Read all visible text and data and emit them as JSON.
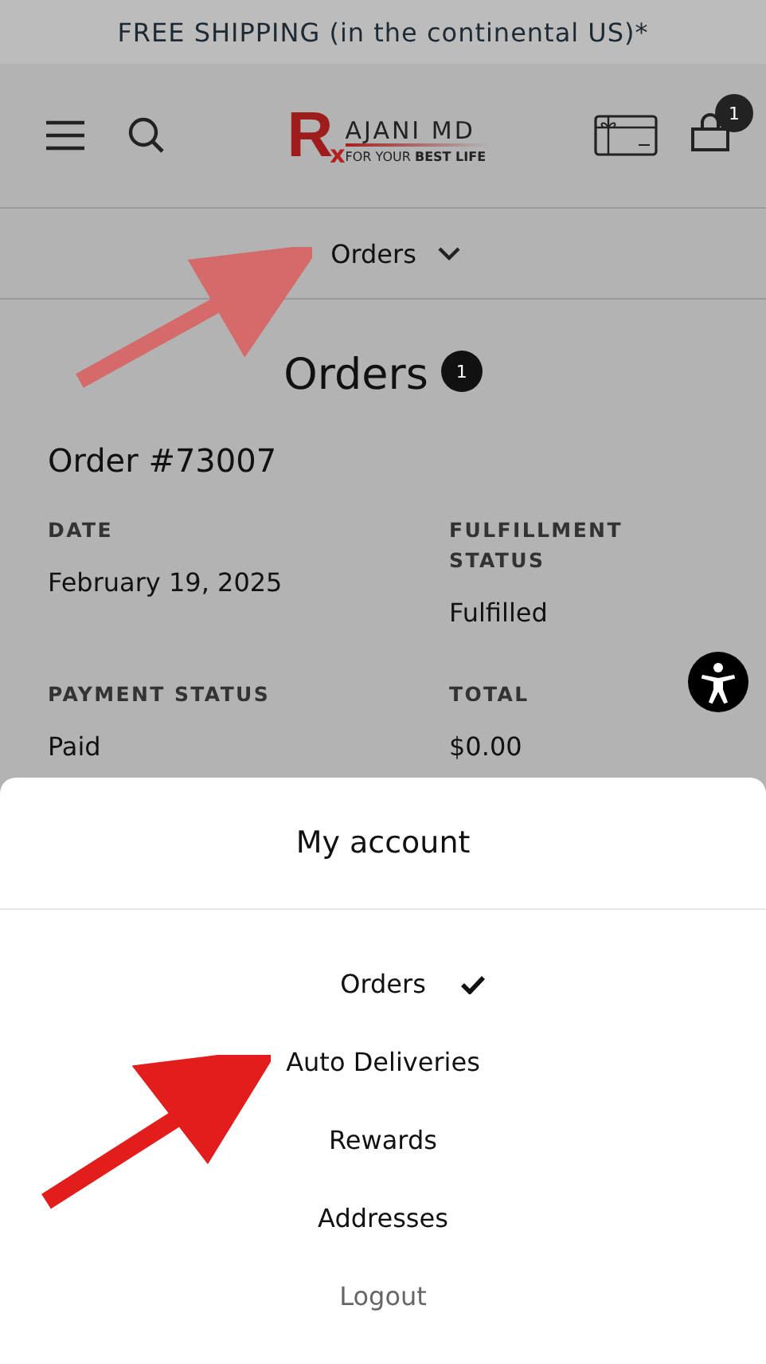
{
  "announcement": "FREE SHIPPING (in the continental US)*",
  "header": {
    "logo": {
      "initial": "R",
      "name": "AJANI MD",
      "subscript": "x",
      "tagline": "FOR YOUR **BEST LIFE**"
    },
    "cart_count": "1"
  },
  "account_nav": {
    "label": "Orders"
  },
  "page": {
    "title": "Orders",
    "count": "1"
  },
  "order": {
    "title": "Order #73007",
    "fields": [
      {
        "label": "DATE",
        "value": "February 19, 2025"
      },
      {
        "label": "FULFILLMENT STATUS",
        "value": "Fulfilled"
      },
      {
        "label": "PAYMENT STATUS",
        "value": "Paid"
      },
      {
        "label": "TOTAL",
        "value": "$0.00"
      }
    ]
  },
  "sheet": {
    "title": "My account",
    "items": [
      {
        "label": "Orders",
        "selected": true,
        "kind": "link"
      },
      {
        "label": "Auto Deliveries",
        "selected": false,
        "kind": "link"
      },
      {
        "label": "Rewards",
        "selected": false,
        "kind": "link"
      },
      {
        "label": "Addresses",
        "selected": false,
        "kind": "link"
      },
      {
        "label": "Logout",
        "selected": false,
        "kind": "logout"
      }
    ]
  }
}
